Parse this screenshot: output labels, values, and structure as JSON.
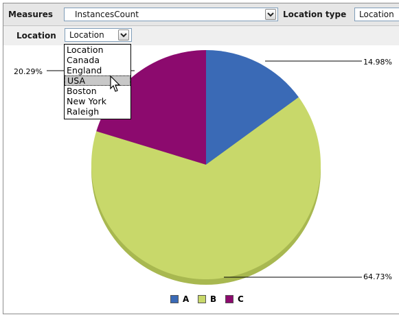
{
  "toolbar": {
    "measures_label": "Measures",
    "measures_value": "InstancesCount",
    "location_type_label": "Location type",
    "location_type_value": "Location"
  },
  "location": {
    "label": "Location",
    "value": "Location",
    "options": [
      "Location",
      "Canada",
      "England",
      "USA",
      "Boston",
      "New York",
      "Raleigh"
    ],
    "highlighted": "USA"
  },
  "chart_data": {
    "type": "pie",
    "categories": [
      "A",
      "B",
      "C"
    ],
    "values": [
      14.98,
      64.73,
      20.29
    ],
    "labels": [
      "14.98%",
      "64.73%",
      "20.29%"
    ],
    "colors": [
      "#3a6ab6",
      "#c8d86a",
      "#8c0a6e"
    ],
    "legend": "bottom",
    "title": "",
    "xlabel": "",
    "ylabel": ""
  }
}
